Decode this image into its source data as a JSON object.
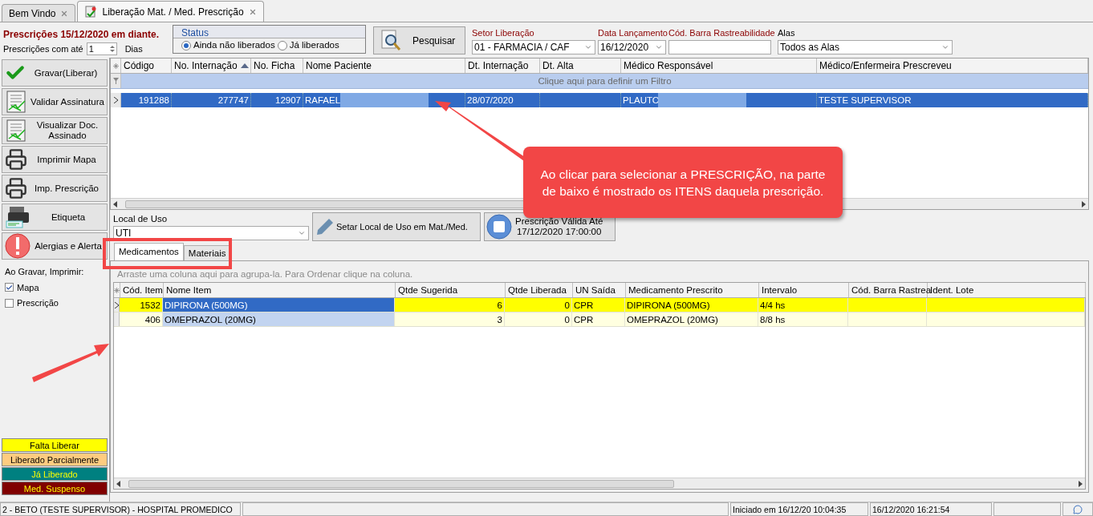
{
  "doc_tabs": [
    {
      "label": "Bem Vindo",
      "selected": false
    },
    {
      "label": "Liberação Mat. / Med. Prescrição",
      "selected": true
    }
  ],
  "header": {
    "title": "Prescrições 15/12/2020 em diante.",
    "days_label": "Prescrições com até",
    "days_value": "1",
    "days_unit": "Dias"
  },
  "status": {
    "title": "Status",
    "options": [
      {
        "label": "Ainda não liberados",
        "selected": true
      },
      {
        "label": "Já liberados",
        "selected": false
      }
    ]
  },
  "search_button": "Pesquisar",
  "filters": [
    {
      "label": "Setor Liberação",
      "color": "#8b0000",
      "value": "01 - FARMACIA / CAF",
      "kind": "dropdown"
    },
    {
      "label": "Data Lançamento",
      "color": "#8b0000",
      "value": "16/12/2020",
      "kind": "dropdown"
    },
    {
      "label": "Cód. Barra Rastreabilidade",
      "color": "#8b0000",
      "kind": "text"
    },
    {
      "label": "Alas",
      "color": "#000000",
      "value": "Todos as Alas",
      "kind": "dropdown"
    }
  ],
  "actions": [
    {
      "label": "Gravar(Liberar)",
      "kind": "check"
    },
    {
      "label": "Validar Assinatura",
      "kind": "document"
    },
    {
      "label": "Visualizar Doc. Assinado",
      "kind": "document"
    },
    {
      "label": "Imprimir Mapa",
      "kind": "printer"
    },
    {
      "label": "Imp. Prescrição",
      "kind": "printer"
    },
    {
      "label": "Etiqueta",
      "kind": "label-printer"
    },
    {
      "label": "Alergias e Alerta",
      "kind": "alert"
    }
  ],
  "print_options": {
    "title": "Ao Gravar, Imprimir:",
    "items": [
      {
        "label": "Mapa",
        "checked": true
      },
      {
        "label": "Prescrição",
        "checked": false
      }
    ]
  },
  "legend": [
    {
      "label": "Falta Liberar",
      "color": "#ffff00"
    },
    {
      "label": "Liberado Parcialmente",
      "color": "#ffcc80"
    },
    {
      "label": "Já Liberado",
      "color": "#008080"
    },
    {
      "label": "Med. Suspenso",
      "color": "#800000"
    }
  ],
  "prescriptions": {
    "columns": [
      {
        "label": "Código",
        "sorted": false
      },
      {
        "label": "No. Internação",
        "sorted": true
      },
      {
        "label": "No. Ficha",
        "sorted": false
      },
      {
        "label": "Nome Paciente",
        "sorted": false
      },
      {
        "label": "Dt. Internação",
        "sorted": false
      },
      {
        "label": "Dt. Alta",
        "sorted": false
      },
      {
        "label": "Médico Responsável",
        "sorted": false
      },
      {
        "label": "Médico/Enfermeira Prescreveu",
        "sorted": false
      }
    ],
    "filter_hint": "Clique aqui para definir um Filtro",
    "rows": [
      {
        "selected": true,
        "cells": [
          {
            "text": "191288"
          },
          {
            "text": "277747"
          },
          {
            "text": "12907"
          },
          {
            "text": "RAFAEL",
            "redacted": true
          },
          {
            "text": "28/07/2020"
          },
          {
            "text": ""
          },
          {
            "text": "PLAUTO",
            "redacted": true
          },
          {
            "text": "TESTE SUPERVISOR"
          }
        ]
      }
    ]
  },
  "local_de_uso": {
    "label": "Local de Uso",
    "value": "UTI"
  },
  "set_button": "Setar Local de Uso em Mat./Med.",
  "validity": {
    "title": "Prescrição Válida Até",
    "value": "17/12/2020 17:00:00"
  },
  "item_tabs": [
    {
      "label": "Medicamentos",
      "selected": true
    },
    {
      "label": "Materiais",
      "selected": false
    }
  ],
  "items": {
    "group_hint": "Arraste uma coluna aqui para agrupa-la. Para Ordenar clique na coluna.",
    "columns": [
      {
        "label": "Cód. Item",
        "focused": false
      },
      {
        "label": "Nome Item",
        "focused": true
      },
      {
        "label": "Qtde Sugerida",
        "focused": false
      },
      {
        "label": "Qtde Liberada",
        "focused": false
      },
      {
        "label": "UN Saída",
        "focused": false
      },
      {
        "label": "Medicamento Prescrito",
        "focused": false
      },
      {
        "label": "Intervalo",
        "focused": false
      },
      {
        "label": "Cód. Barra Rastrea",
        "focused": false
      },
      {
        "label": "Ident. Lote",
        "focused": false
      }
    ],
    "rows": [
      {
        "selected": true,
        "color": "#ffff00",
        "cells": [
          "1532",
          "DIPIRONA (500MG)",
          "6",
          "0",
          "CPR",
          "DIPIRONA (500MG)",
          "4/4 hs",
          "",
          ""
        ]
      },
      {
        "selected": false,
        "color": "#ffffe0",
        "cells": [
          "406",
          "OMEPRAZOL (20MG)",
          "3",
          "0",
          "CPR",
          "OMEPRAZOL (20MG)",
          "8/8 hs",
          "",
          ""
        ]
      }
    ]
  },
  "callout": "Ao clicar para selecionar a PRESCRIÇÃO, na parte de baixo é mostrado os ITENS daquela prescrição.",
  "status_bar": [
    "2 - BETO (TESTE SUPERVISOR) - HOSPITAL PROMEDICO",
    "Iniciado em 16/12/20 10:04:35",
    "16/12/2020 16:21:54"
  ]
}
